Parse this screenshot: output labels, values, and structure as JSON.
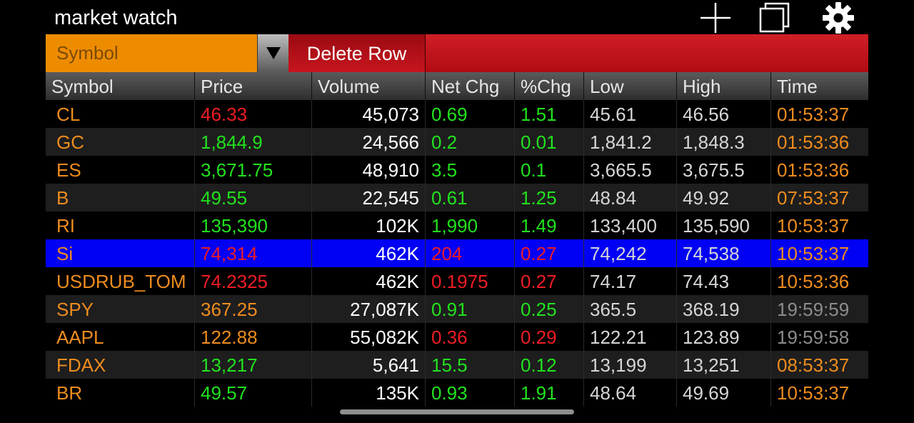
{
  "app": {
    "title": "market watch"
  },
  "icons": {
    "add": "plus-icon",
    "window": "copy-window-icon",
    "settings": "gear-icon"
  },
  "toolbar": {
    "symbol_placeholder": "Symbol",
    "delete_label": "Delete Row"
  },
  "colors": {
    "accent_orange": "#ee8c00",
    "delete_red": "#c7151e",
    "selection_blue": "#0000f4",
    "up_green": "#22e21e",
    "down_red": "#ee1c24"
  },
  "table": {
    "columns": [
      "Symbol",
      "Price",
      "Volume",
      "Net Chg",
      "%Chg",
      "Low",
      "High",
      "Time"
    ],
    "selected_row": 5,
    "rows": [
      {
        "symbol": "CL",
        "price": "46.33",
        "price_color": "red",
        "volume": "45,073",
        "net_chg": "0.69",
        "pct_chg": "1.51",
        "chg_color": "green",
        "low": "45.61",
        "high": "46.56",
        "time": "01:53:37",
        "time_color": "orange"
      },
      {
        "symbol": "GC",
        "price": "1,844.9",
        "price_color": "green",
        "volume": "24,566",
        "net_chg": "0.2",
        "pct_chg": "0.01",
        "chg_color": "green",
        "low": "1,841.2",
        "high": "1,848.3",
        "time": "01:53:36",
        "time_color": "orange"
      },
      {
        "symbol": "ES",
        "price": "3,671.75",
        "price_color": "green",
        "volume": "48,910",
        "net_chg": "3.5",
        "pct_chg": "0.1",
        "chg_color": "green",
        "low": "3,665.5",
        "high": "3,675.5",
        "time": "01:53:36",
        "time_color": "orange"
      },
      {
        "symbol": "B",
        "price": "49.55",
        "price_color": "green",
        "volume": "22,545",
        "net_chg": "0.61",
        "pct_chg": "1.25",
        "chg_color": "green",
        "low": "48.84",
        "high": "49.92",
        "time": "07:53:37",
        "time_color": "orange"
      },
      {
        "symbol": "RI",
        "price": "135,390",
        "price_color": "green",
        "volume": "102K",
        "net_chg": "1,990",
        "pct_chg": "1.49",
        "chg_color": "green",
        "low": "133,400",
        "high": "135,590",
        "time": "10:53:37",
        "time_color": "orange"
      },
      {
        "symbol": "Si",
        "price": "74,314",
        "price_color": "red",
        "volume": "462K",
        "net_chg": "204",
        "pct_chg": "0.27",
        "chg_color": "red",
        "low": "74,242",
        "high": "74,538",
        "time": "10:53:37",
        "time_color": "orange"
      },
      {
        "symbol": "USDRUB_TOM",
        "price": "74.2325",
        "price_color": "red",
        "volume": "462K",
        "net_chg": "0.1975",
        "pct_chg": "0.27",
        "chg_color": "red",
        "low": "74.17",
        "high": "74.43",
        "time": "10:53:36",
        "time_color": "orange"
      },
      {
        "symbol": "SPY",
        "price": "367.25",
        "price_color": "orange",
        "volume": "27,087K",
        "net_chg": "0.91",
        "pct_chg": "0.25",
        "chg_color": "green",
        "low": "365.5",
        "high": "368.19",
        "time": "19:59:59",
        "time_color": "grey"
      },
      {
        "symbol": "AAPL",
        "price": "122.88",
        "price_color": "orange",
        "volume": "55,082K",
        "net_chg": "0.36",
        "pct_chg": "0.29",
        "chg_color": "red",
        "low": "122.21",
        "high": "123.89",
        "time": "19:59:58",
        "time_color": "grey"
      },
      {
        "symbol": "FDAX",
        "price": "13,217",
        "price_color": "green",
        "volume": "5,641",
        "net_chg": "15.5",
        "pct_chg": "0.12",
        "chg_color": "green",
        "low": "13,199",
        "high": "13,251",
        "time": "08:53:37",
        "time_color": "orange"
      },
      {
        "symbol": "BR",
        "price": "49.57",
        "price_color": "green",
        "volume": "135K",
        "net_chg": "0.93",
        "pct_chg": "1.91",
        "chg_color": "green",
        "low": "48.64",
        "high": "49.69",
        "time": "10:53:37",
        "time_color": "orange"
      }
    ]
  }
}
